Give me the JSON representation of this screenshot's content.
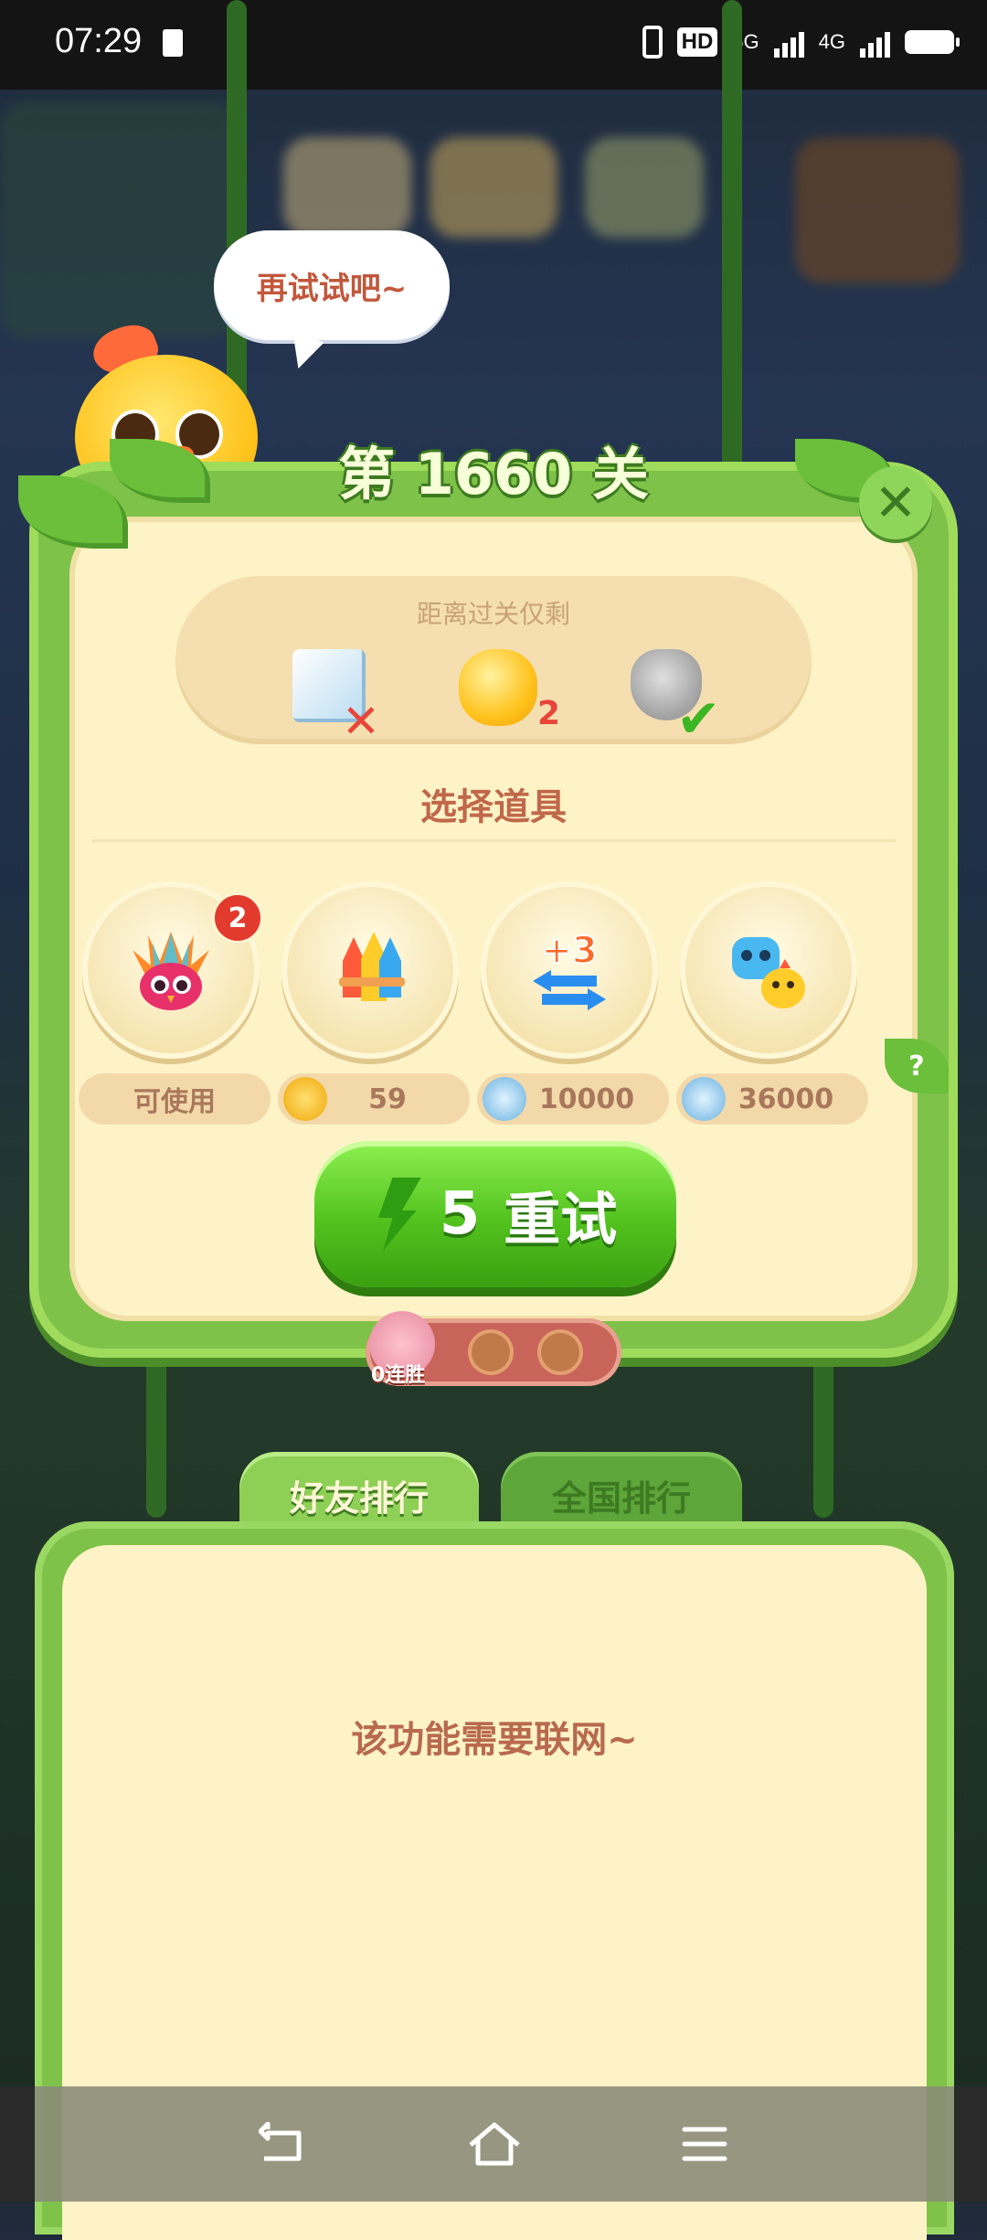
{
  "status_bar": {
    "time": "07:29",
    "network_hd": "HD",
    "network_5g": "5G",
    "network_4g": "4G"
  },
  "bubble": {
    "text": "再试试吧~"
  },
  "level": {
    "title": "第 1660 关"
  },
  "goals": {
    "label": "距离过关仅剩",
    "items": [
      {
        "icon": "ice-block-icon",
        "status": "failed"
      },
      {
        "icon": "yellow-jelly-icon",
        "count": "2"
      },
      {
        "icon": "gray-cat-icon",
        "status": "done"
      }
    ]
  },
  "booster_section": {
    "title": "选择道具",
    "items": [
      {
        "icon": "rainbow-owl-icon",
        "badge": "2",
        "price": "可使用"
      },
      {
        "icon": "rockets-icon",
        "price": "59",
        "currency": "gold-coin-icon"
      },
      {
        "icon": "plus-three-moves-icon",
        "price": "10000",
        "currency": "silver-coin-icon"
      },
      {
        "icon": "hippo-chick-swap-icon",
        "price": "36000",
        "currency": "silver-coin-icon"
      }
    ],
    "help": "?"
  },
  "retry_button": {
    "cost": "5",
    "label": "重试"
  },
  "streak": {
    "text": "0连胜"
  },
  "leaderboard": {
    "tabs": [
      {
        "label": "好友排行",
        "active": true
      },
      {
        "label": "全国排行",
        "active": false
      }
    ],
    "message": "该功能需要联网~"
  },
  "colors": {
    "panel_green": "#7fc24a",
    "panel_cream": "#fdf3c7",
    "retry_green": "#52c21e",
    "title_brown": "#c0684a"
  }
}
